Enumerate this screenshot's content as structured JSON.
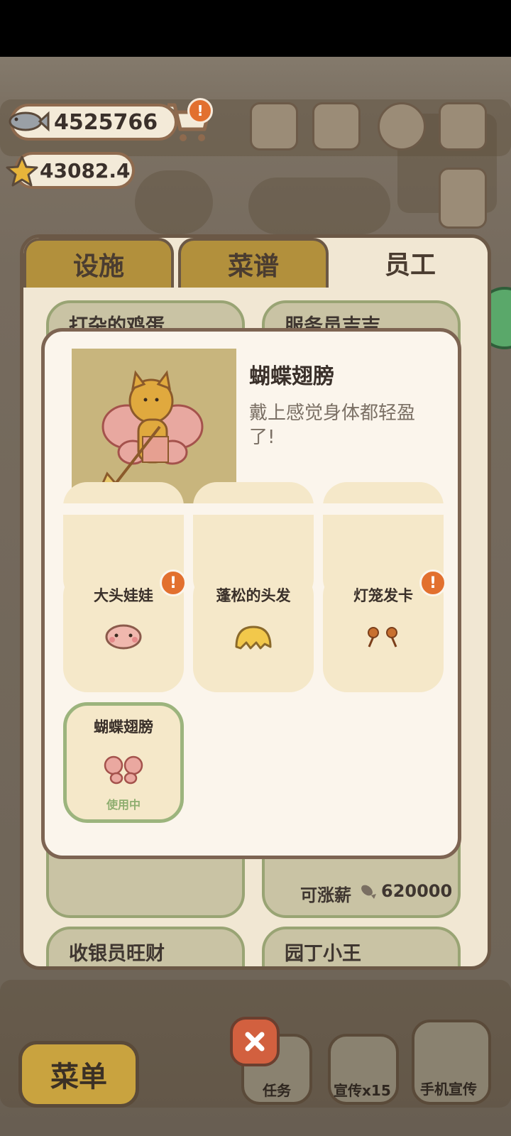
{
  "currency": {
    "fish": "4525766",
    "stars": "43082.4"
  },
  "panel": {
    "tabs": [
      {
        "label": "设施",
        "active": false
      },
      {
        "label": "菜谱",
        "active": false
      },
      {
        "label": "员工",
        "active": true
      }
    ],
    "employees": [
      {
        "name": "打杂的鸡蛋"
      },
      {
        "name": "服务员吉吉"
      },
      {
        "name": "收银员旺财"
      },
      {
        "name": "园丁小王"
      }
    ],
    "raise_label": "可涨薪",
    "raise_value": "620000"
  },
  "modal": {
    "title": "蝴蝶翅膀",
    "description": "戴上感觉身体都轻盈了!",
    "items": [
      {
        "name": "大头娃娃",
        "alert": true,
        "selected": false
      },
      {
        "name": "蓬松的头发",
        "alert": false,
        "selected": false
      },
      {
        "name": "灯笼发卡",
        "alert": true,
        "selected": false
      },
      {
        "name": "蝴蝶翅膀",
        "alert": false,
        "selected": true,
        "status": "使用中"
      }
    ]
  },
  "bottom": {
    "menu": "菜单",
    "task": "任务",
    "promo": "宣传x15",
    "phone_promo": "手机宣传"
  },
  "colors": {
    "accent_orange": "#e2702f",
    "selected_green": "#9cb47d",
    "tab_gold": "#b2903c"
  }
}
